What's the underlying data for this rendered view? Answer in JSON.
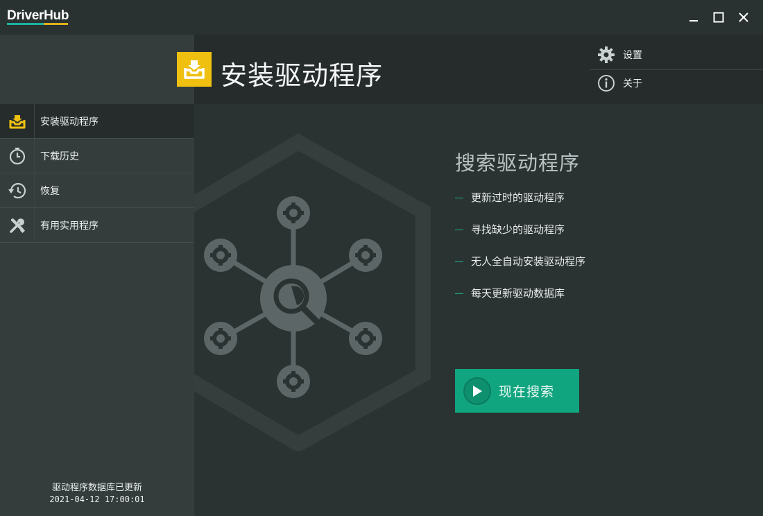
{
  "app": {
    "logo": "DriverHub"
  },
  "window_controls": {
    "minimize": "minimize-icon",
    "maximize": "maximize-icon",
    "close": "close-icon"
  },
  "sidebar": {
    "items": [
      {
        "label": "安装驱动程序",
        "icon": "install-tray-icon",
        "active": true
      },
      {
        "label": "下载历史",
        "icon": "clock-icon",
        "active": false
      },
      {
        "label": "恢复",
        "icon": "history-icon",
        "active": false
      },
      {
        "label": "有用实用程序",
        "icon": "tools-icon",
        "active": false
      }
    ],
    "db_status": {
      "text": "驱动程序数据库已更新",
      "timestamp": "2021-04-12 17:00:01"
    }
  },
  "header": {
    "title": "安装驱动程序",
    "icon": "install-tray-icon",
    "menu": [
      {
        "label": "设置",
        "icon": "gear-icon"
      },
      {
        "label": "关于",
        "icon": "info-icon"
      }
    ]
  },
  "main": {
    "heading": "搜索驱动程序",
    "features": [
      "更新过时的驱动程序",
      "寻找缺少的驱动程序",
      "无人全自动安装驱动程序",
      "每天更新驱动数据库"
    ],
    "scan_button": "现在搜索"
  },
  "colors": {
    "accent_green": "#11a57f",
    "accent_yellow": "#f0c010",
    "background": "#2b3232",
    "sidebar": "#343c3c"
  }
}
